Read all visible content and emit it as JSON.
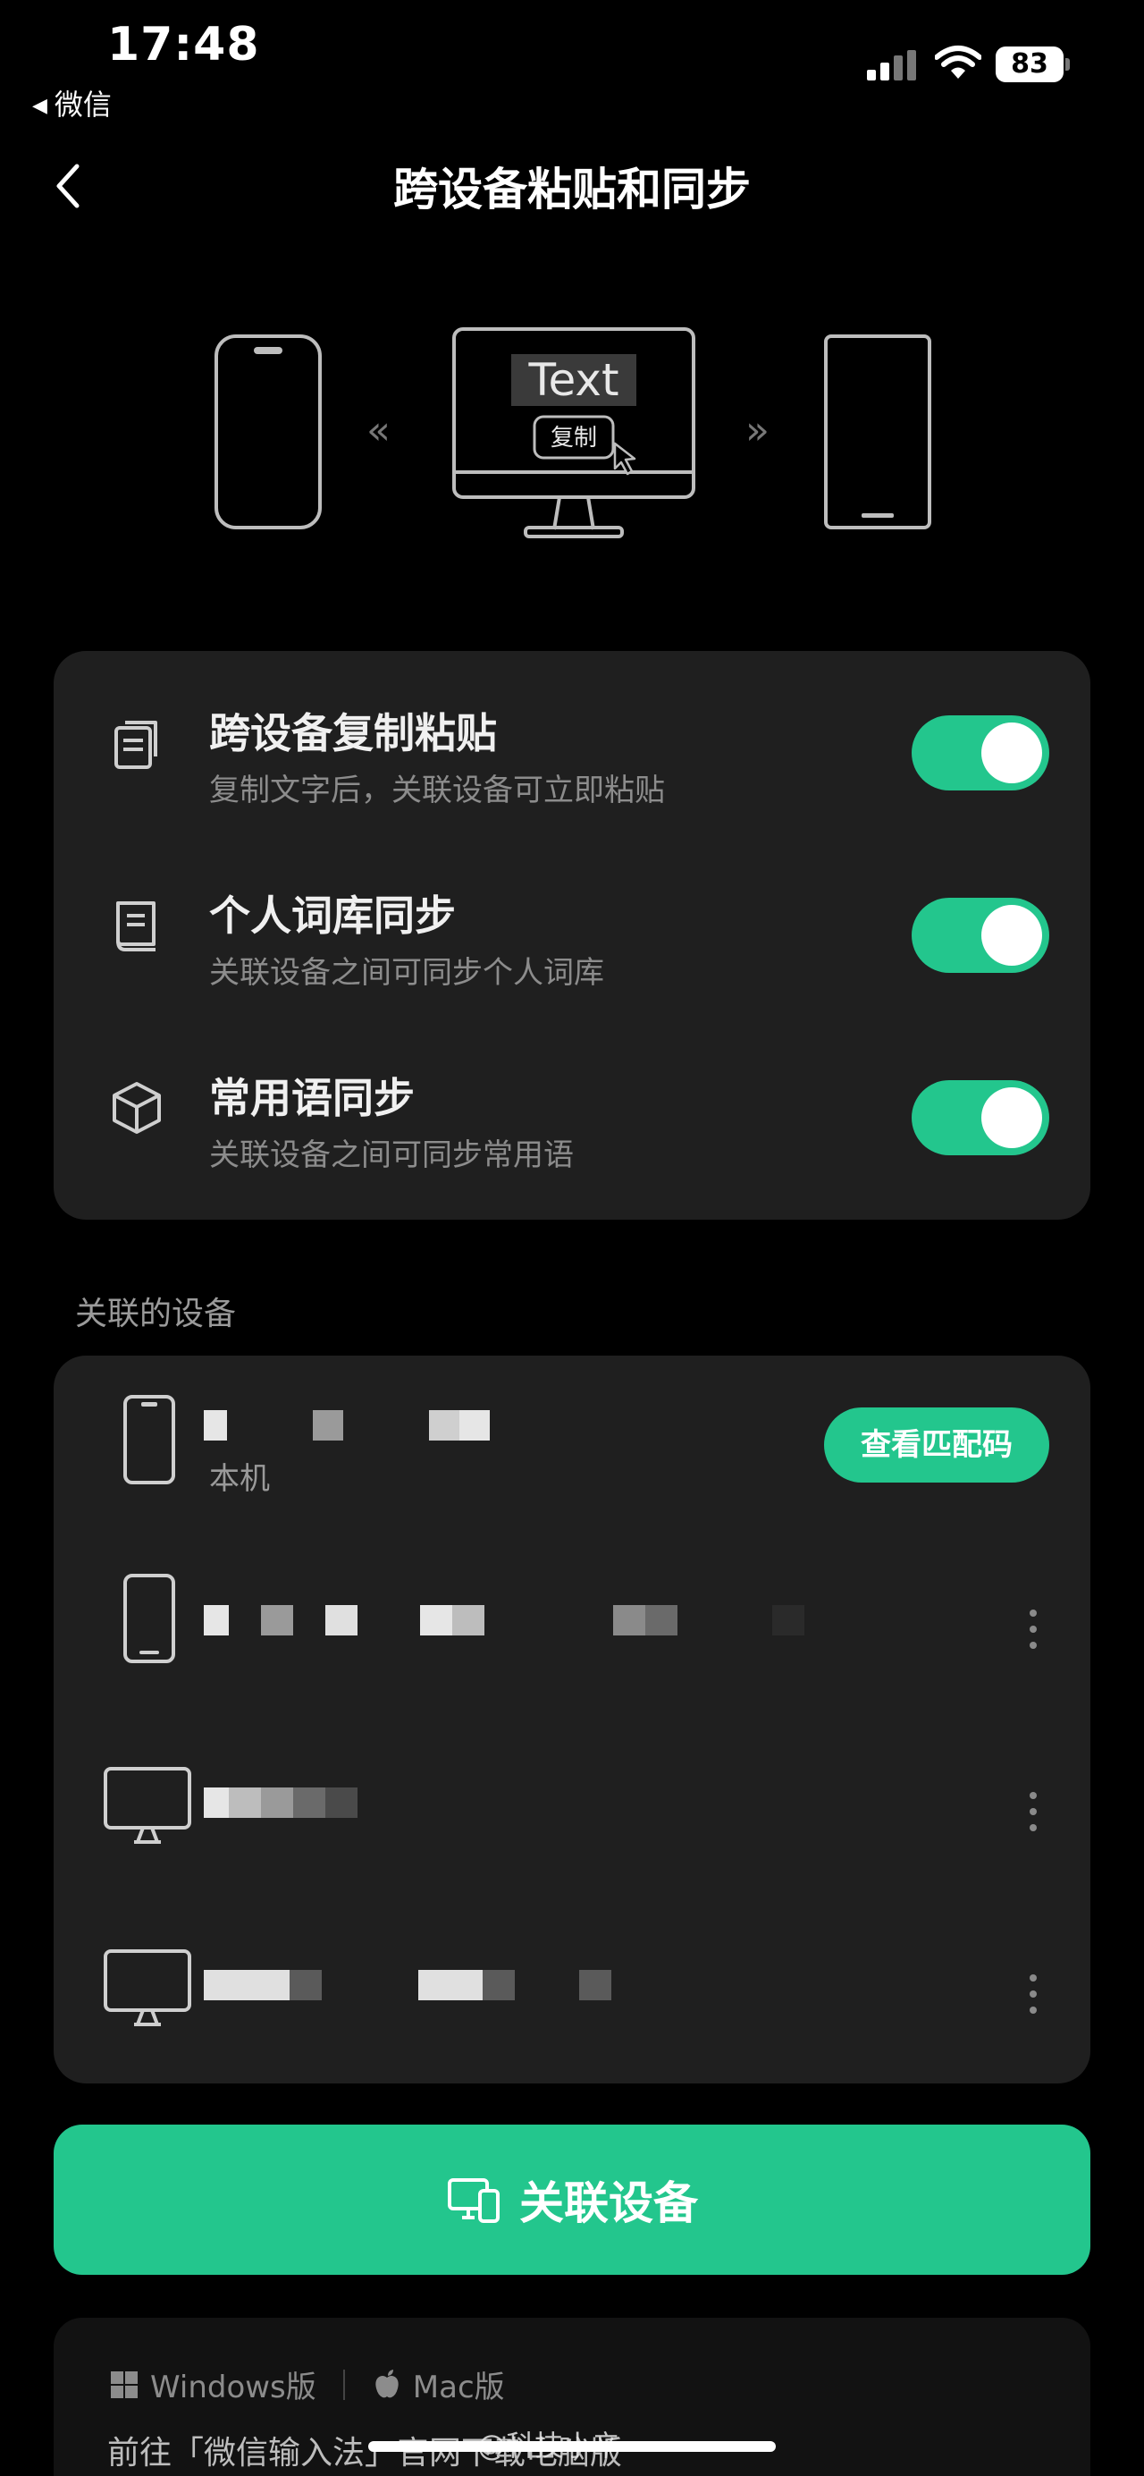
{
  "status_bar": {
    "time": "17:48",
    "back_app": "微信",
    "battery": "83"
  },
  "nav": {
    "title": "跨设备粘贴和同步"
  },
  "illustration": {
    "sample_text": "Text",
    "copy_label": "复制"
  },
  "settings": [
    {
      "title": "跨设备复制粘贴",
      "desc": "复制文字后，关联设备可立即粘贴",
      "icon": "clipboard-copy-icon",
      "enabled": true
    },
    {
      "title": "个人词库同步",
      "desc": "关联设备之间可同步个人词库",
      "icon": "book-icon",
      "enabled": true
    },
    {
      "title": "常用语同步",
      "desc": "关联设备之间可同步常用语",
      "icon": "cube-icon",
      "enabled": true
    }
  ],
  "devices_section": {
    "label": "关联的设备",
    "this_device_label": "本机",
    "pair_code_button": "查看匹配码",
    "devices": [
      {
        "type": "phone",
        "icon": "phone-icon"
      },
      {
        "type": "phone",
        "icon": "phone-icon"
      },
      {
        "type": "desktop",
        "icon": "monitor-icon"
      },
      {
        "type": "desktop",
        "icon": "monitor-icon"
      }
    ]
  },
  "link_button": {
    "label": "关联设备",
    "icon": "devices-icon"
  },
  "download": {
    "windows_label": "Windows版",
    "mac_label": "Mac版",
    "text": "前往「微信输入法」官网下载电脑版"
  },
  "watermark": "@科技小辛",
  "colors": {
    "accent": "#23c68d",
    "card_bg": "#1f1f1f",
    "page_bg": "#000000"
  }
}
